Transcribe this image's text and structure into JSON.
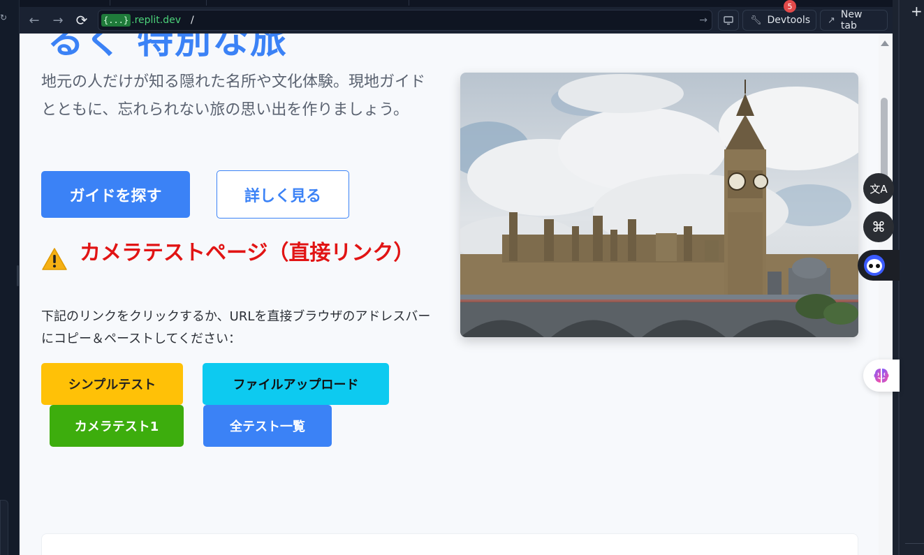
{
  "browser": {
    "url_tag": "{...}",
    "url_host": ".replit.dev",
    "url_path": "/",
    "devtools_label": "Devtools",
    "devtools_badge": "5",
    "newtab_label": "New tab"
  },
  "page": {
    "hero_title": "るく 特別な旅",
    "lead": "地元の人だけが知る隠れた名所や文化体験。現地ガイドとともに、忘れられない旅の思い出を作りましょう。",
    "primary_button": "ガイドを探す",
    "outline_button": "詳しく見る",
    "warning_title": "カメラテストページ（直接リンク）",
    "note": "下記のリンクをクリックするか、URLを直接ブラウザのアドレスバーにコピー＆ペーストしてください：",
    "test_buttons": {
      "simple": "シンプルテスト",
      "upload": "ファイルアップロード",
      "camera1": "カメラテスト1",
      "all": "全テスト一覧"
    },
    "image": {
      "subject": "Big Ben and Houses of Parliament, London"
    }
  },
  "colors": {
    "accent": "#3b82f6",
    "warning_red": "#e11414",
    "yellow": "#ffc107",
    "cyan": "#0dcaf0",
    "green": "#3dad0d"
  },
  "extensions": {
    "translate_glyph": "文A",
    "cmd_glyph": "⌘"
  }
}
